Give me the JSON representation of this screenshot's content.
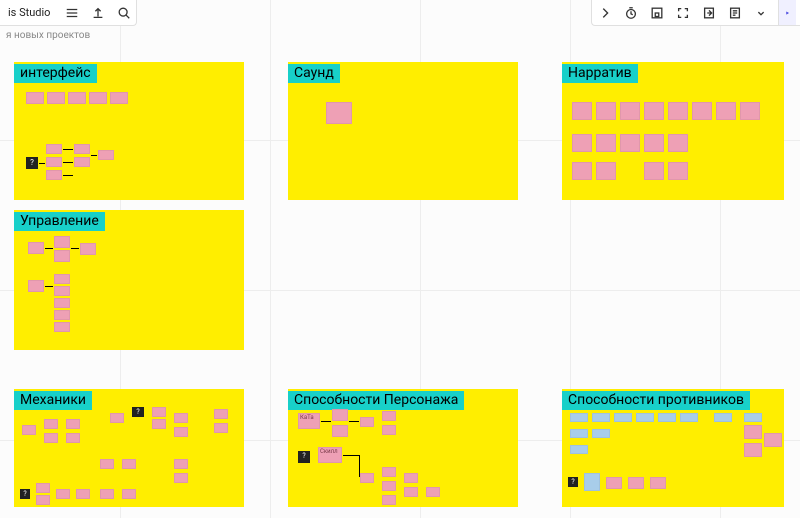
{
  "app": {
    "brand": "is Studio",
    "subtitle": "я новых проектов"
  },
  "toolbar_left": {
    "menu": "menu",
    "upload": "upload",
    "search": "search"
  },
  "toolbar_right": {
    "collapse": "collapse",
    "timer": "timer",
    "screen": "screen",
    "fullscreen": "fullscreen",
    "export": "export",
    "notes": "notes",
    "more": "more",
    "present": "present"
  },
  "frames": {
    "interface": {
      "title": "интерфейс"
    },
    "sound": {
      "title": "Саунд"
    },
    "narrative": {
      "title": "Нарратив"
    },
    "control": {
      "title": "Управление"
    },
    "mechanics": {
      "title": "Механики"
    },
    "abilities": {
      "title": "Способности Персонажа"
    },
    "enemies": {
      "title": "Способности противников"
    }
  },
  "stickies": {
    "question": "?",
    "kata": "КаТа",
    "kill": "Скилл"
  }
}
